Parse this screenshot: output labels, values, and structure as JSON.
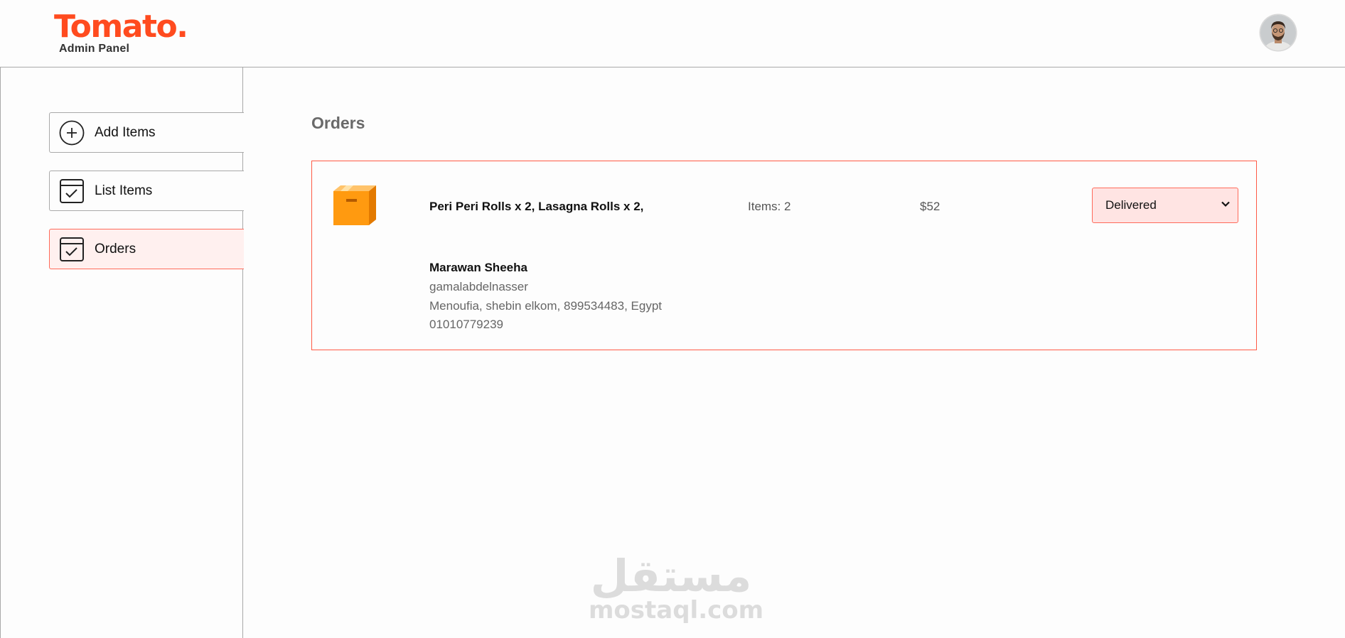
{
  "brand": {
    "logo_text": "Tomato.",
    "subtitle": "Admin Panel",
    "accent_color": "#ff4b1f"
  },
  "header": {
    "avatar_icon": "profile-avatar"
  },
  "sidebar": {
    "items": [
      {
        "label": "Add Items",
        "icon": "add-circle-icon",
        "active": false
      },
      {
        "label": "List Items",
        "icon": "checklist-icon",
        "active": false
      },
      {
        "label": "Orders",
        "icon": "checklist-icon",
        "active": true
      }
    ]
  },
  "main": {
    "title": "Orders",
    "orders": [
      {
        "icon": "parcel-icon",
        "items_text": "Peri Peri Rolls x 2, Lasagna Rolls x 2,",
        "count_text": "Items: 2",
        "amount": "$52",
        "status": "Delivered",
        "customer": {
          "name": "Marawan Sheeha",
          "street": "gamalabdelnasser",
          "address": "Menoufia, shebin elkom, 899534483, Egypt",
          "phone": "01010779239"
        }
      }
    ]
  },
  "watermark": {
    "arabic": "مستقل",
    "latin": "mostaql.com"
  }
}
